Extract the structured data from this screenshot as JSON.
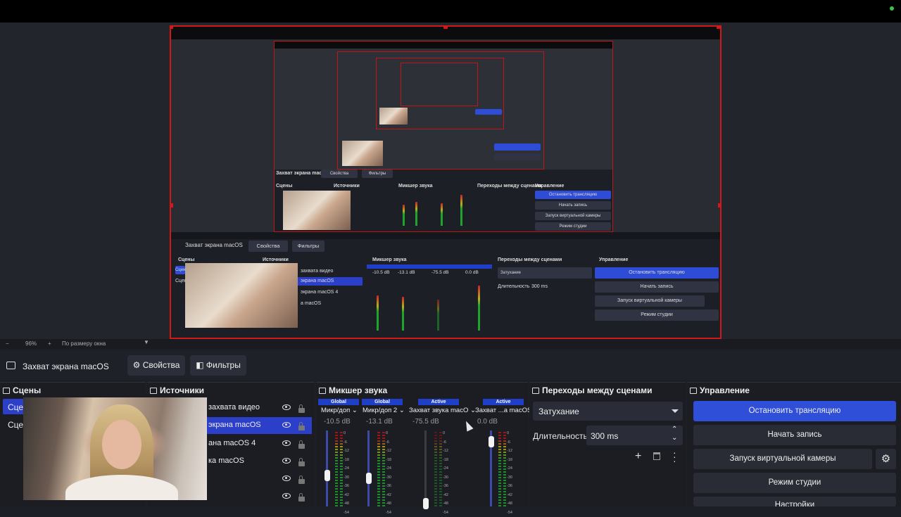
{
  "indicator_color": "#3ec24a",
  "accent_color": "#2f4fd8",
  "selection_color": "#d41818",
  "preview": {
    "nested_labels": {
      "source_name": "Захват экрана macOS",
      "properties": "Свойства",
      "filters": "Фильтры",
      "scenes": "Сцены",
      "sources": "Источники",
      "mixer": "Микшер звука",
      "transitions": "Переходы между сценами",
      "controls": "Управление",
      "stop_stream": "Остановить трансляцию",
      "start_record": "Начать запись",
      "virtual_cam": "Запуск виртуальной камеры",
      "studio": "Режим студии",
      "fade": "Затухание",
      "duration": "Длительность",
      "duration_value": "300 ms",
      "nested_sources": [
        "захвата видео",
        "экрана macOS",
        "экрана macOS 4",
        "а macOS"
      ],
      "nested_scene_1": "Сцен",
      "nested_scene_2": "Сцен",
      "global": "Global",
      "active": "Active",
      "mic1": "Микр/доп",
      "mic2": "Микр/доп 2",
      "capture": "Захват звука macO",
      "capture2": "Захват ...а macOS",
      "db1": "-10.5 dB",
      "db2": "-13.1 dB",
      "db3": "-75.5 dB",
      "db4": "0.0 dB",
      "zoom": "96%",
      "fit": "По размеру окна"
    }
  },
  "zoombar": {
    "zoom_value": "96%",
    "fit_label": "По размеру окна"
  },
  "source_bar": {
    "source_name": "Захват экрана macOS",
    "properties_label": "Свойства",
    "filters_label": "Фильтры"
  },
  "scenes": {
    "title": "Сцены",
    "items": [
      "Сцен",
      "Сцен"
    ]
  },
  "sources": {
    "title": "Источники",
    "items": [
      {
        "label": "захвата видео",
        "selected": false
      },
      {
        "label": "экрана macOS",
        "selected": true
      },
      {
        "label": "ана macOS 4",
        "selected": false
      },
      {
        "label": "ка macOS",
        "selected": false
      },
      {
        "label": "",
        "selected": false
      },
      {
        "label": "",
        "selected": false
      }
    ]
  },
  "mixer": {
    "title": "Микшер звука",
    "channels": [
      {
        "tag": "Global",
        "name": "Микр/доп",
        "db": "-10.5 dB",
        "level": 0.42
      },
      {
        "tag": "Global",
        "name": "Микр/доп 2",
        "db": "-13.1 dB",
        "level": 0.37
      },
      {
        "tag": "Active",
        "name": "Захват звука macO",
        "db": "-75.5 dB",
        "level": 0.0
      },
      {
        "tag": "Active",
        "name": "Захват ...а macOS",
        "db": "0.0 dB",
        "level": 0.92
      }
    ],
    "scale_marks": [
      "0",
      "-6",
      "-12",
      "-18",
      "-24",
      "-30",
      "-36",
      "-42",
      "-48",
      "-54"
    ]
  },
  "transitions": {
    "title": "Переходы между сценами",
    "selected": "Затухание",
    "duration_label": "Длительность",
    "duration_value": "300 ms"
  },
  "controls": {
    "title": "Управление",
    "stop_stream": "Остановить трансляцию",
    "start_record": "Начать запись",
    "virtual_camera": "Запуск виртуальной камеры",
    "studio_mode": "Режим студии",
    "settings": "Настройки"
  }
}
